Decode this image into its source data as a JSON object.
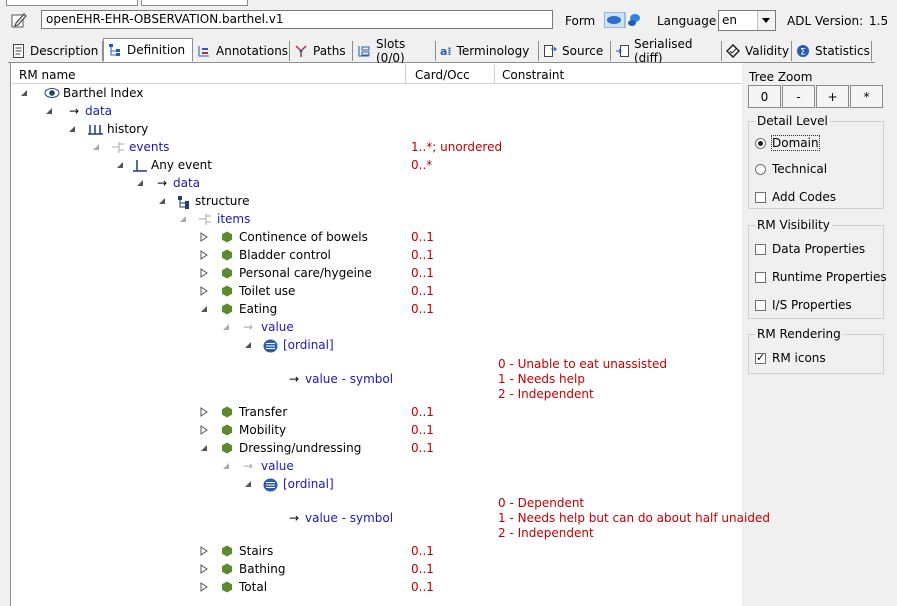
{
  "header": {
    "archetype_id": "openEHR-EHR-OBSERVATION.barthel.v1",
    "form_label": "Form",
    "language_label": "Language",
    "language_value": "en",
    "adl_version_label": "ADL Version:",
    "adl_version_value": "1.5"
  },
  "tabs": [
    {
      "label": "Description",
      "icon": "description-icon"
    },
    {
      "label": "Definition",
      "icon": "definition-tree-icon",
      "active": true
    },
    {
      "label": "Annotations",
      "icon": "annotations-icon"
    },
    {
      "label": "Paths",
      "icon": "paths-icon"
    },
    {
      "label": "Slots (0/0)",
      "icon": "slots-icon"
    },
    {
      "label": "Terminology",
      "icon": "terminology-icon"
    },
    {
      "label": "Source",
      "icon": "source-icon"
    },
    {
      "label": "Serialised (diff)",
      "icon": "serialised-icon"
    },
    {
      "label": "Validity",
      "icon": "validity-icon"
    },
    {
      "label": "Statistics",
      "icon": "statistics-icon"
    }
  ],
  "columns": {
    "rm_name": "RM name",
    "card_occ": "Card/Occ",
    "constraint": "Constraint"
  },
  "tree": {
    "barthel_index": "Barthel Index",
    "data": "data",
    "history": "history",
    "events": "events",
    "events_card": "1..*; unordered",
    "any_event": "Any event",
    "any_event_card": "0..*",
    "data2": "data",
    "structure": "structure",
    "items": "items",
    "continence": "Continence of bowels",
    "bladder": "Bladder control",
    "personal_care": "Personal care/hygeine",
    "toilet": "Toilet use",
    "eating": "Eating",
    "value": "value",
    "ordinal": "[ordinal]",
    "value_symbol": "value - symbol",
    "eating_constraints": [
      "0 - Unable to eat unassisted",
      "1 - Needs help",
      "2 - Independent"
    ],
    "transfer": "Transfer",
    "mobility": "Mobility",
    "dressing": "Dressing/undressing",
    "dressing_constraints": [
      "0 - Dependent",
      "1 - Needs help but can do about half unaided",
      "2 - Independent"
    ],
    "stairs": "Stairs",
    "bathing": "Bathing",
    "total": "Total",
    "occ_01": "0..1",
    "arrow": "→"
  },
  "right_panel": {
    "tree_zoom": "Tree Zoom",
    "zoom_buttons": [
      "0",
      "-",
      "+",
      "*"
    ],
    "detail_level": "Detail Level",
    "domain": "Domain",
    "technical": "Technical",
    "add_codes": "Add Codes",
    "rm_visibility": "RM Visibility",
    "data_properties": "Data Properties",
    "runtime_properties": "Runtime Properties",
    "is_properties": "I/S Properties",
    "rm_rendering": "RM Rendering",
    "rm_icons": "RM icons"
  },
  "colors": {
    "constraint_red": "#c00000",
    "attribute_blue": "#1a1ab3",
    "element_green": "#5c8a2e"
  }
}
